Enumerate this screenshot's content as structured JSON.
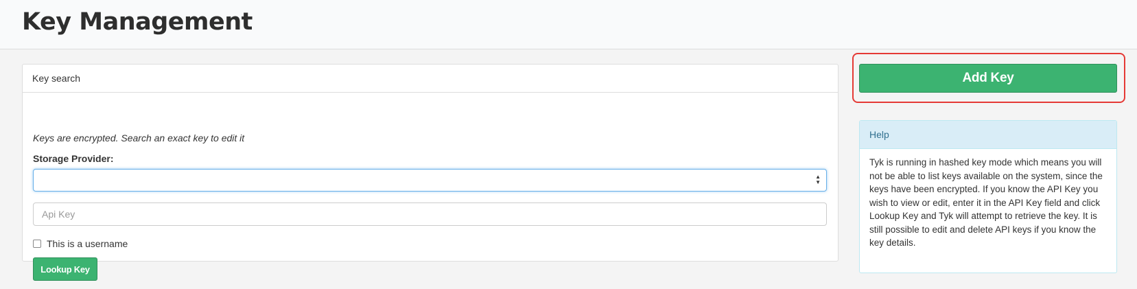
{
  "header": {
    "title": "Key Management"
  },
  "key_search": {
    "panel_title": "Key search",
    "intro_text": "Keys are encrypted. Search an exact key to edit it",
    "storage_label": "Storage Provider:",
    "storage_selected": "",
    "api_key_placeholder": "Api Key",
    "api_key_value": "",
    "username_checkbox_label": "This is a username",
    "username_checked": false,
    "lookup_button_label": "Lookup Key"
  },
  "sidebar": {
    "add_key_label": "Add Key",
    "help_title": "Help",
    "help_text": "Tyk is running in hashed key mode which means you will not be able to list keys available on the system, since the keys have been encrypted. If you know the API Key you wish to view or edit, enter it in the API Key field and click Lookup Key and Tyk will attempt to retrieve the key. It is still possible to edit and delete API keys if you know the key details."
  },
  "colors": {
    "primary_green": "#3cb371",
    "highlight_red": "#e53935",
    "help_header_bg": "#d9edf7",
    "help_header_text": "#31708f"
  },
  "icons": {
    "select_arrows": "select-arrows-icon"
  }
}
